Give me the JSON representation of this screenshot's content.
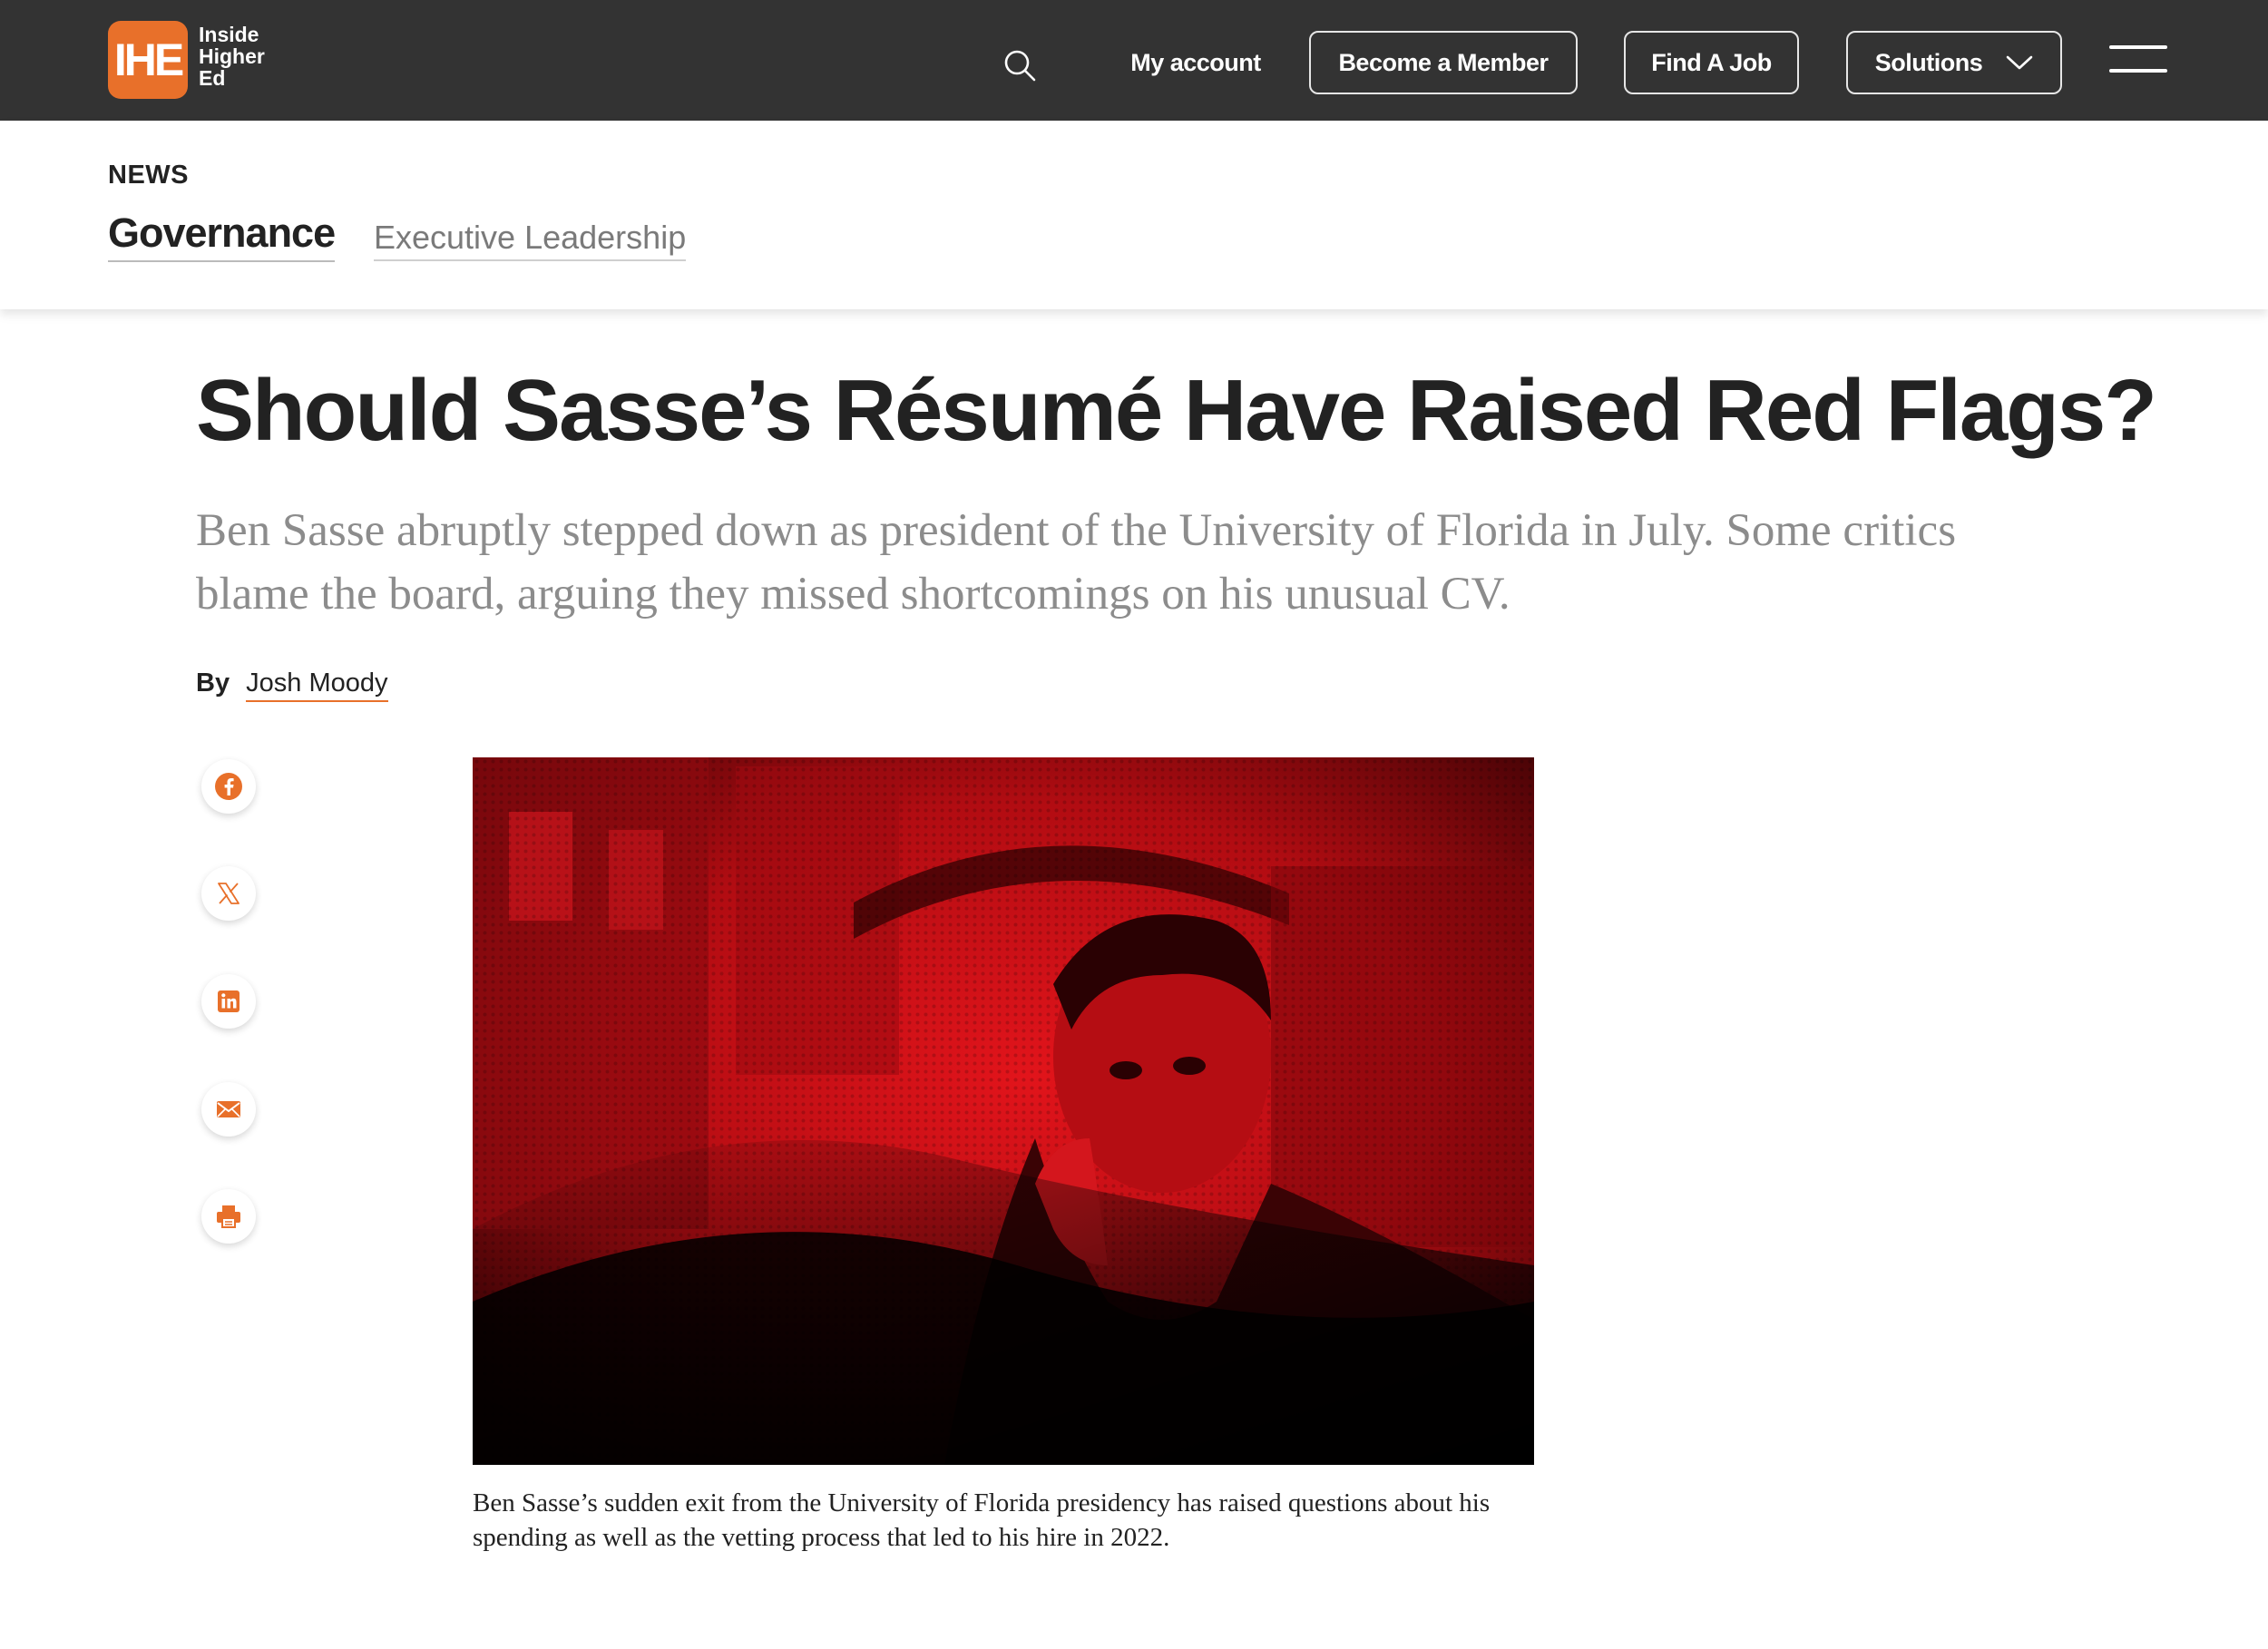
{
  "header": {
    "logo_mark": "IHE",
    "brand_lines": [
      "Inside",
      "Higher",
      "Ed"
    ],
    "icons": {
      "search": "search-icon",
      "menu": "hamburger-menu-icon",
      "dropdown": "chevron-down-icon"
    },
    "nav": {
      "my_account": "My account",
      "become_member": "Become a Member",
      "find_job": "Find A Job",
      "solutions": "Solutions"
    },
    "colors": {
      "bar": "#333333",
      "accent": "#e8702a"
    }
  },
  "section": {
    "kicker": "NEWS",
    "primary": "Governance",
    "secondary": "Executive Leadership"
  },
  "article": {
    "headline": "Should Sasse’s Résumé Have Raised Red Flags?",
    "dek": "Ben Sasse abruptly stepped down as president of the University of Florida in July. Some critics blame the board, arguing they missed shortcomings on his unusual CV.",
    "byline_prefix": "By",
    "author": "Josh Moody",
    "share_icons": [
      "facebook-icon",
      "x-icon",
      "linkedin-icon",
      "email-icon",
      "print-icon"
    ],
    "caption": "Ben Sasse’s sudden exit from the University of Florida presidency has raised questions about his spending as well as the vetting process that led to his hire in 2022."
  }
}
